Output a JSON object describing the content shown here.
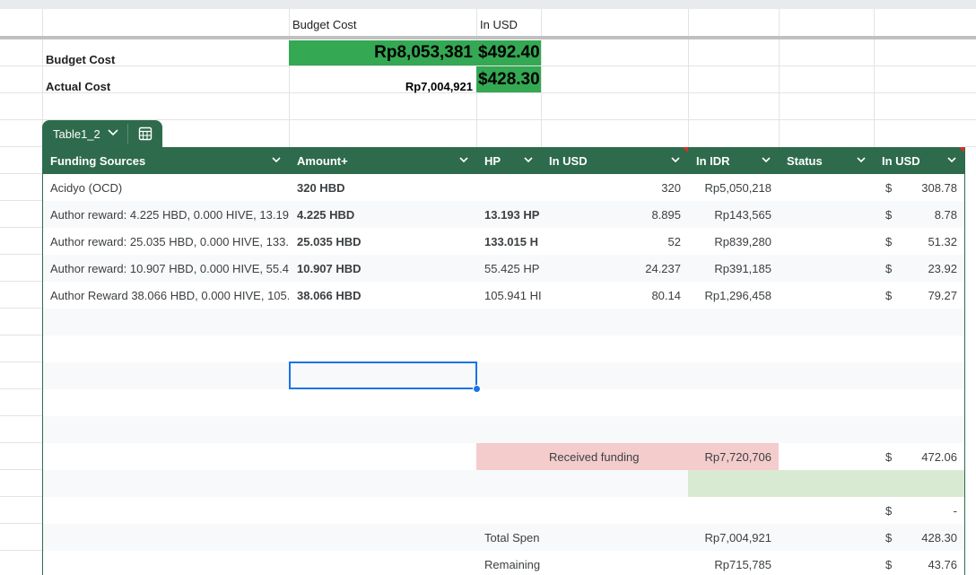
{
  "summary": {
    "header_budget": "Budget Cost",
    "header_usd": "In USD",
    "budget_label": "Budget Cost",
    "budget_idr": "Rp8,053,381",
    "budget_usd": "$492.40",
    "actual_label": "Actual Cost",
    "actual_idr": "Rp7,004,921",
    "actual_usd": "$428.30"
  },
  "table": {
    "name": "Table1_2",
    "headers": [
      "Funding Sources",
      "Amount+",
      "HP",
      "In USD",
      "In IDR",
      "Status",
      "In USD"
    ],
    "rows": [
      {
        "source": "Acidyo (OCD)",
        "amount": "320 HBD",
        "hp": "",
        "usd": "320",
        "idr": "Rp5,050,218",
        "status": "",
        "cur": "$",
        "usd2": "308.78"
      },
      {
        "source": "Author reward: 4.225 HBD, 0.000 HIVE, 13.19",
        "amount": "4.225 HBD",
        "hp": "13.193 HP",
        "usd": "8.895",
        "idr": "Rp143,565",
        "status": "",
        "cur": "$",
        "usd2": "8.78"
      },
      {
        "source": "Author reward: 25.035 HBD, 0.000 HIVE, 133.",
        "amount": "25.035 HBD",
        "hp": "133.015 H",
        "usd": "52",
        "idr": "Rp839,280",
        "status": "",
        "cur": "$",
        "usd2": "51.32"
      },
      {
        "source": "Author reward: 10.907 HBD, 0.000 HIVE, 55.4",
        "amount": "10.907 HBD",
        "hp": "55.425 HP",
        "usd": "24.237",
        "idr": "Rp391,185",
        "status": "",
        "cur": "$",
        "usd2": "23.92"
      },
      {
        "source": "Author Reward 38.066 HBD, 0.000 HIVE, 105.",
        "amount": "38.066 HBD",
        "hp": "105.941 HI",
        "usd": "80.14",
        "idr": "Rp1,296,458",
        "status": "",
        "cur": "$",
        "usd2": "79.27"
      }
    ],
    "received_label": "Received funding",
    "received_idr": "Rp7,720,706",
    "received_cur": "$",
    "received_usd": "472.06",
    "dash_cur": "$",
    "dash_val": "-",
    "total_label": "Total Spen",
    "total_idr": "Rp7,004,921",
    "total_cur": "$",
    "total_usd": "428.30",
    "remaining_label": "Remaining",
    "remaining_idr": "Rp715,785",
    "remaining_cur": "$",
    "remaining_usd": "43.76"
  },
  "colors": {
    "table_header": "#2e6b4c",
    "highlight_green": "#34a853",
    "pink_fill": "#f4cccc",
    "light_green_fill": "#d9ead3",
    "selection": "#1a73e8"
  }
}
